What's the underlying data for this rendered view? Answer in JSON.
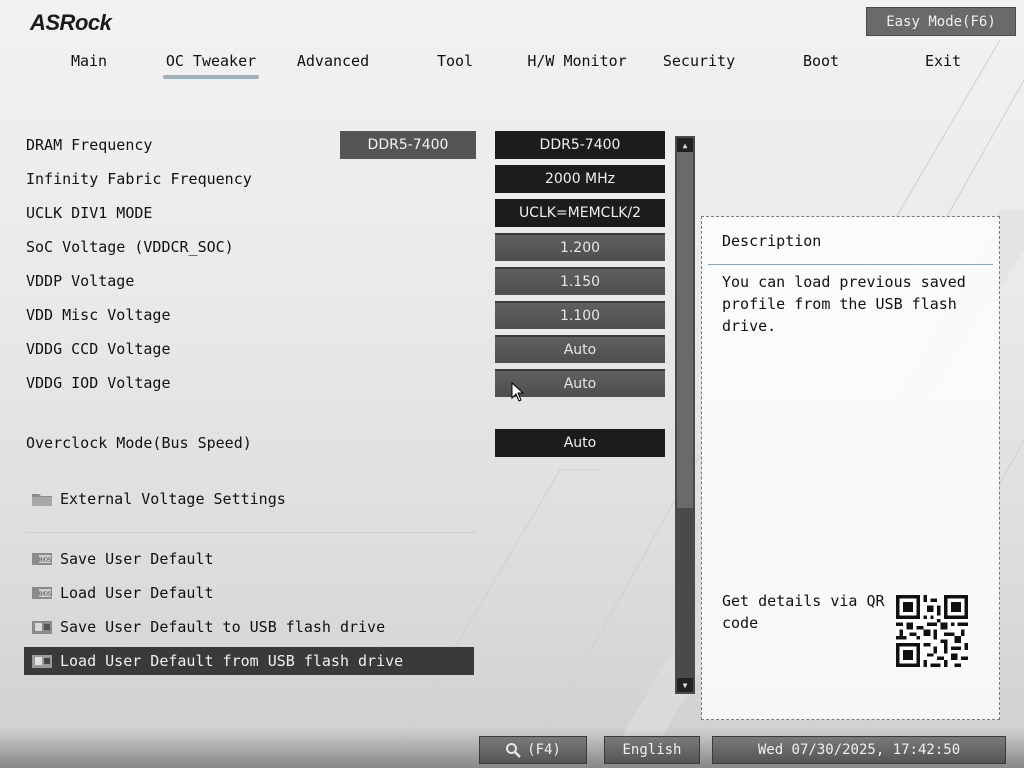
{
  "brand": {
    "logo": "ASRock"
  },
  "header": {
    "easy_mode_label": "Easy Mode(F6)"
  },
  "nav": {
    "tabs": [
      {
        "label": "Main"
      },
      {
        "label": "OC Tweaker",
        "active": true
      },
      {
        "label": "Advanced"
      },
      {
        "label": "Tool"
      },
      {
        "label": "H/W Monitor"
      },
      {
        "label": "Security"
      },
      {
        "label": "Boot"
      },
      {
        "label": "Exit"
      }
    ]
  },
  "settings": [
    {
      "label": "DRAM Frequency",
      "current": "DDR5-7400",
      "value": "DDR5-7400",
      "style": "dark"
    },
    {
      "label": "Infinity Fabric Frequency",
      "value": "2000 MHz",
      "style": "dark"
    },
    {
      "label": "UCLK DIV1 MODE",
      "value": "UCLK=MEMCLK/2",
      "style": "dark"
    },
    {
      "label": "SoC Voltage (VDDCR_SOC)",
      "value": "1.200",
      "style": "gray"
    },
    {
      "label": "VDDP Voltage",
      "value": "1.150",
      "style": "gray"
    },
    {
      "label": "VDD Misc Voltage",
      "value": "1.100",
      "style": "gray"
    },
    {
      "label": "VDDG CCD Voltage",
      "value": "Auto",
      "style": "gray"
    },
    {
      "label": "VDDG IOD Voltage",
      "value": "Auto",
      "style": "gray"
    },
    {
      "label": "Overclock Mode(Bus Speed)",
      "value": "Auto",
      "style": "dark"
    }
  ],
  "submenu": {
    "label": "External Voltage Settings",
    "icon": "folder-icon"
  },
  "profile_items": [
    {
      "label": "Save User Default",
      "icon": "bios-chip-icon"
    },
    {
      "label": "Load User Default",
      "icon": "bios-chip-icon"
    },
    {
      "label": "Save User Default to USB flash drive",
      "icon": "usb-drive-icon"
    },
    {
      "label": "Load User Default from USB flash drive",
      "icon": "usb-drive-icon",
      "selected": true
    }
  ],
  "description": {
    "title": "Description",
    "text": "You can load previous saved profile from the USB flash drive.",
    "qr_text": "Get details via QR code"
  },
  "footer": {
    "search_label": "(F4)",
    "language": "English",
    "datetime": "Wed 07/30/2025, 17:42:50"
  },
  "colors": {
    "accent_tab_underline": "#9fb0bd",
    "value_dark": "#1c1c1c",
    "value_gray": "#555555",
    "selected_row": "#3a3a3a"
  }
}
